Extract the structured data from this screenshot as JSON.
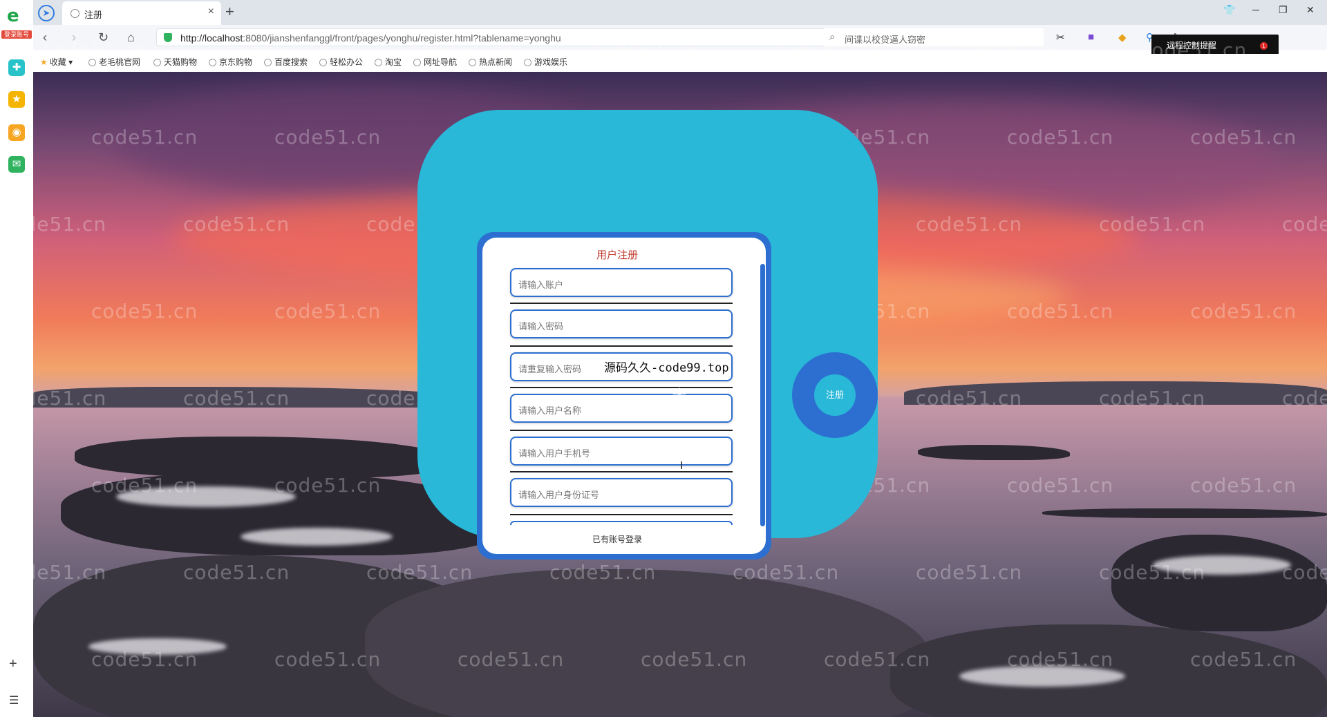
{
  "browser": {
    "logo_badge": "登录账号",
    "tab_title": "注册",
    "url_host": "http://localhost",
    "url_rest": ":8080/jianshenfanggl/front/pages/yonghu/register.html?tablename=yonghu",
    "search_placeholder": "间谍以校贷逼人窃密",
    "remote_label": "远程控制提醒",
    "remote_count": "1"
  },
  "bookmarks": [
    {
      "label": "收藏"
    },
    {
      "label": "老毛桃官网"
    },
    {
      "label": "天猫购物"
    },
    {
      "label": "京东购物"
    },
    {
      "label": "百度搜索"
    },
    {
      "label": "轻松办公"
    },
    {
      "label": "淘宝"
    },
    {
      "label": "网址导航"
    },
    {
      "label": "热点新闻"
    },
    {
      "label": "游戏娱乐"
    }
  ],
  "watermark": "code51.cn",
  "form": {
    "title": "用户注册",
    "fields": [
      {
        "placeholder": "请输入账户"
      },
      {
        "placeholder": "请输入密码"
      },
      {
        "placeholder": "请重复输入密码"
      },
      {
        "placeholder": "请输入用户名称"
      },
      {
        "placeholder": "请输入用户手机号"
      },
      {
        "placeholder": "请输入用户身份证号"
      }
    ],
    "login_link": "已有账号登录",
    "register_button": "注册"
  },
  "overlay_text": "源码久久-code99.top"
}
